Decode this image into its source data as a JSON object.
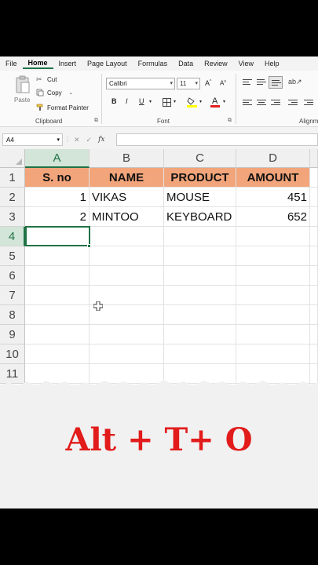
{
  "menu": {
    "tabs": [
      "File",
      "Home",
      "Insert",
      "Page Layout",
      "Formulas",
      "Data",
      "Review",
      "View",
      "Help"
    ],
    "active": "Home"
  },
  "ribbon": {
    "clipboard": {
      "paste": "Paste",
      "cut": "Cut",
      "copy": "Copy",
      "format_painter": "Format Painter",
      "label": "Clipboard"
    },
    "font": {
      "name": "Calibri",
      "size": "11",
      "bold": "B",
      "italic": "I",
      "underline": "U",
      "label": "Font"
    },
    "alignment": {
      "label": "Alignm"
    }
  },
  "formula_bar": {
    "name_box": "A4",
    "fx": "fx",
    "value": ""
  },
  "sheet": {
    "columns": [
      "A",
      "B",
      "C",
      "D"
    ],
    "rows": [
      "1",
      "2",
      "3",
      "4",
      "5",
      "6",
      "7",
      "8",
      "9",
      "10",
      "11"
    ],
    "header_row": [
      "S. no",
      "NAME",
      "PRODUCT",
      "AMOUNT"
    ],
    "data": [
      [
        "1",
        "VIKAS",
        "MOUSE",
        "451"
      ],
      [
        "2",
        "MINTOO",
        "KEYBOARD",
        "652"
      ]
    ],
    "active_cell": "A4",
    "header_fill": "#f2a57a",
    "accent": "#217346"
  },
  "overlay": {
    "shortcut": "Alt + T+ O"
  }
}
